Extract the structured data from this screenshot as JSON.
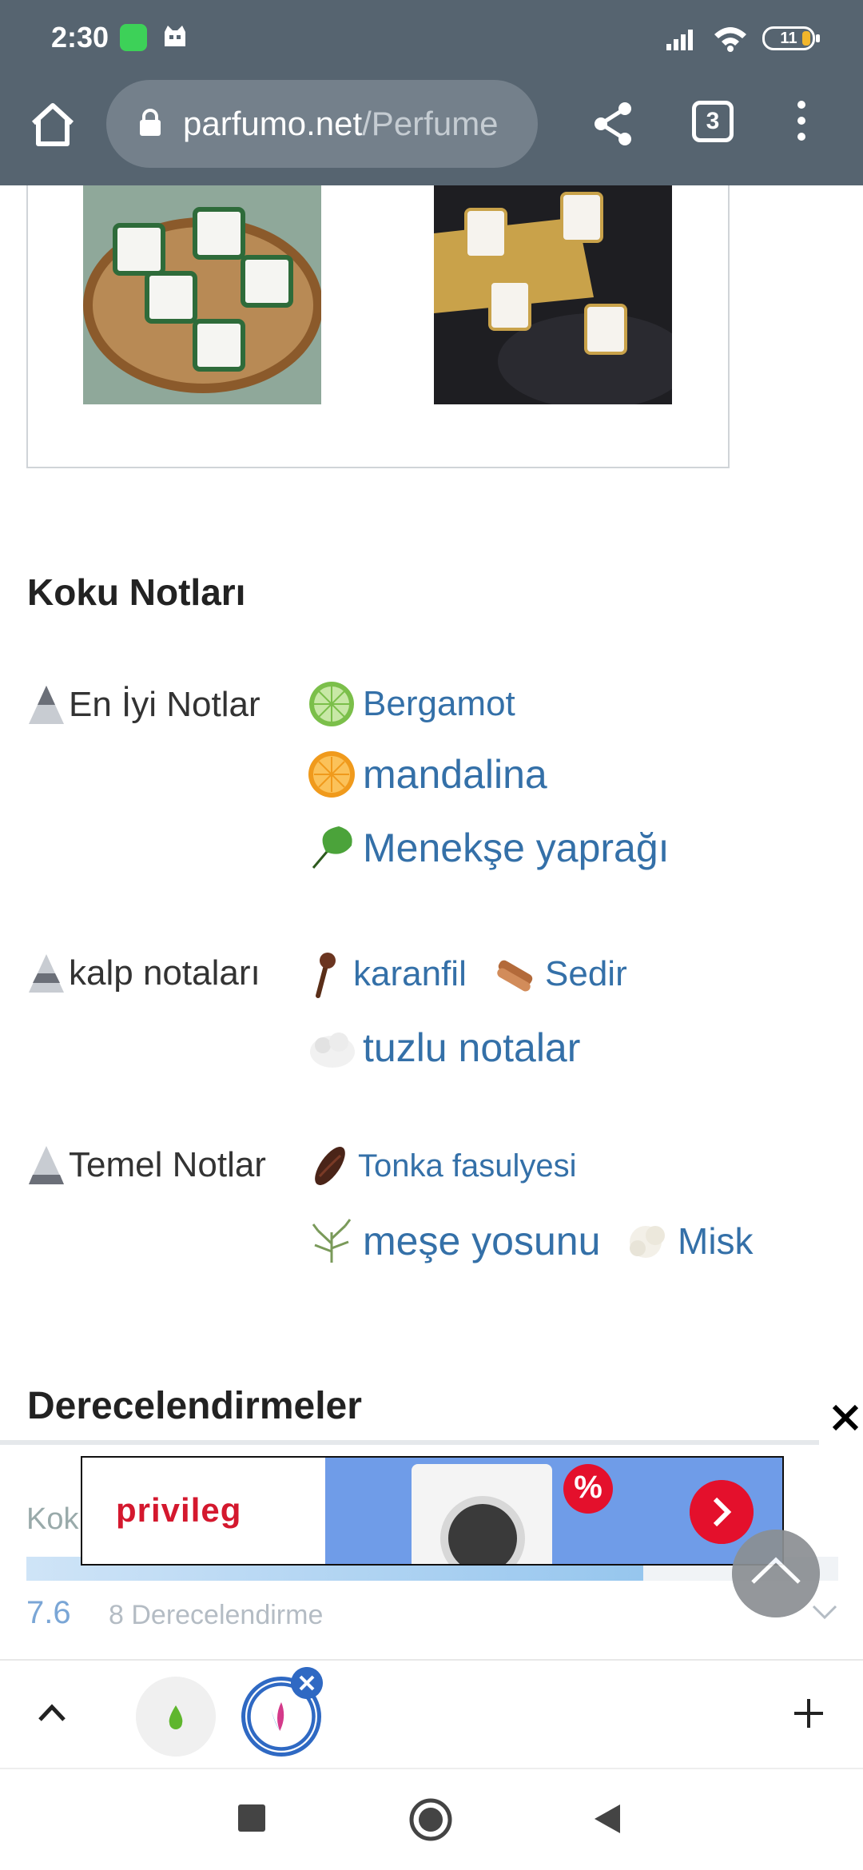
{
  "status_bar": {
    "time": "2:30",
    "battery_level": "11"
  },
  "browser": {
    "url_host": "parfumo.net",
    "url_path": "/Perfume",
    "tab_count": "3"
  },
  "notes_section": {
    "title": "Koku Notları",
    "groups": [
      {
        "label": "En İyi Notlar",
        "notes": [
          "Bergamot",
          "mandalina",
          "Menekşe yaprağı"
        ]
      },
      {
        "label": "kalp notaları",
        "notes": [
          "karanfil",
          "Sedir",
          "tuzlu notalar"
        ]
      },
      {
        "label": "Temel Notlar",
        "notes": [
          "Tonka fasulyesi",
          "meşe yosunu",
          "Misk"
        ]
      }
    ]
  },
  "ratings": {
    "title": "Derecelendirmeler",
    "partial_label": "Kok",
    "score": "7.6",
    "count": "8 Derecelendirme",
    "fill_fraction": 0.76
  },
  "ad": {
    "brand": "privileg",
    "badge": "%"
  },
  "colors": {
    "toolbar": "#566470",
    "link": "#3470a8",
    "ad_red": "#e4102c",
    "ad_blue": "#6f9ce8"
  }
}
